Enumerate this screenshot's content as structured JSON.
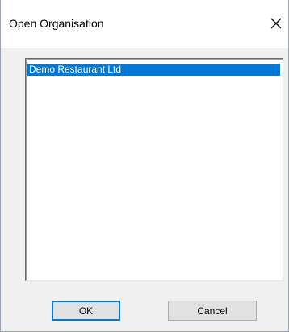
{
  "window": {
    "title": "Open Organisation",
    "close_icon": "close-icon"
  },
  "organisation_list": {
    "items": [
      {
        "label": "Demo Restaurant Ltd",
        "selected": true
      }
    ]
  },
  "buttons": {
    "ok_label": "OK",
    "cancel_label": "Cancel"
  },
  "colors": {
    "selection": "#0078d7",
    "dialog_background": "#f0f0f0",
    "titlebar_background": "#ffffff"
  }
}
